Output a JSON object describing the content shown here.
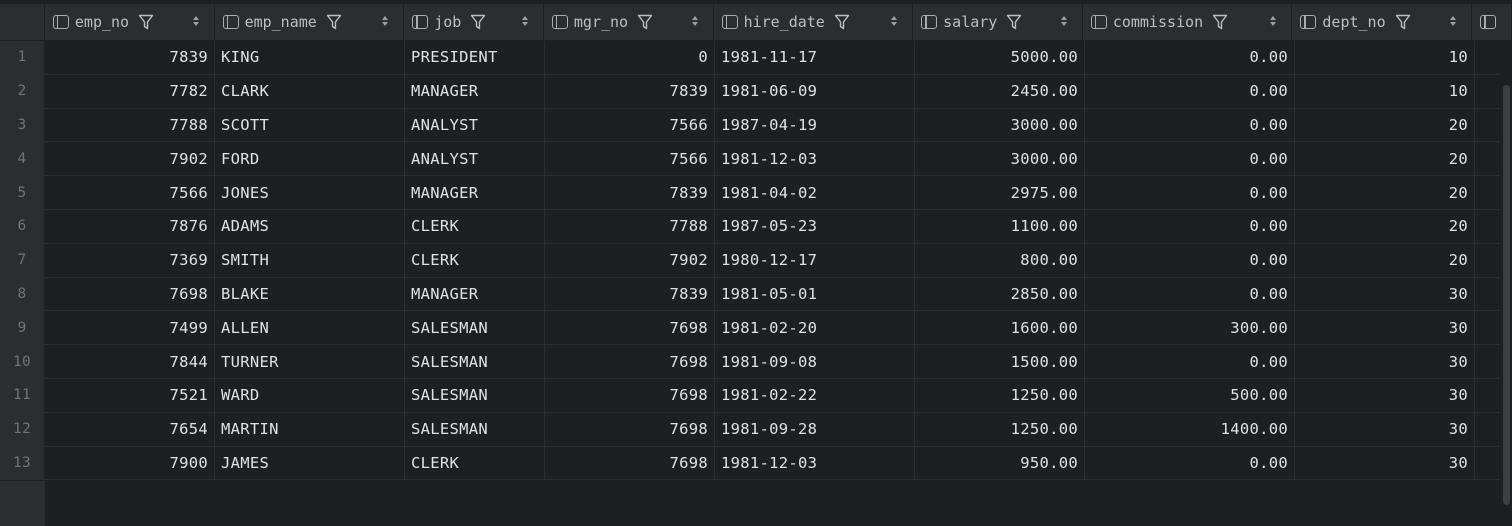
{
  "columns": [
    {
      "name": "emp_no",
      "sort": true
    },
    {
      "name": "emp_name",
      "sort": true
    },
    {
      "name": "job",
      "sort": true
    },
    {
      "name": "mgr_no",
      "sort": true
    },
    {
      "name": "hire_date",
      "sort": true
    },
    {
      "name": "salary",
      "sort": true
    },
    {
      "name": "commission",
      "sort": true
    },
    {
      "name": "dept_no",
      "sort": true
    }
  ],
  "rows": [
    {
      "n": "1",
      "emp_no": "7839",
      "emp_name": "KING",
      "job": "PRESIDENT",
      "mgr_no": "0",
      "hire_date": "1981-11-17",
      "salary": "5000.00",
      "commission": "0.00",
      "dept_no": "10"
    },
    {
      "n": "2",
      "emp_no": "7782",
      "emp_name": "CLARK",
      "job": "MANAGER",
      "mgr_no": "7839",
      "hire_date": "1981-06-09",
      "salary": "2450.00",
      "commission": "0.00",
      "dept_no": "10"
    },
    {
      "n": "3",
      "emp_no": "7788",
      "emp_name": "SCOTT",
      "job": "ANALYST",
      "mgr_no": "7566",
      "hire_date": "1987-04-19",
      "salary": "3000.00",
      "commission": "0.00",
      "dept_no": "20"
    },
    {
      "n": "4",
      "emp_no": "7902",
      "emp_name": "FORD",
      "job": "ANALYST",
      "mgr_no": "7566",
      "hire_date": "1981-12-03",
      "salary": "3000.00",
      "commission": "0.00",
      "dept_no": "20"
    },
    {
      "n": "5",
      "emp_no": "7566",
      "emp_name": "JONES",
      "job": "MANAGER",
      "mgr_no": "7839",
      "hire_date": "1981-04-02",
      "salary": "2975.00",
      "commission": "0.00",
      "dept_no": "20"
    },
    {
      "n": "6",
      "emp_no": "7876",
      "emp_name": "ADAMS",
      "job": "CLERK",
      "mgr_no": "7788",
      "hire_date": "1987-05-23",
      "salary": "1100.00",
      "commission": "0.00",
      "dept_no": "20"
    },
    {
      "n": "7",
      "emp_no": "7369",
      "emp_name": "SMITH",
      "job": "CLERK",
      "mgr_no": "7902",
      "hire_date": "1980-12-17",
      "salary": "800.00",
      "commission": "0.00",
      "dept_no": "20"
    },
    {
      "n": "8",
      "emp_no": "7698",
      "emp_name": "BLAKE",
      "job": "MANAGER",
      "mgr_no": "7839",
      "hire_date": "1981-05-01",
      "salary": "2850.00",
      "commission": "0.00",
      "dept_no": "30"
    },
    {
      "n": "9",
      "emp_no": "7499",
      "emp_name": "ALLEN",
      "job": "SALESMAN",
      "mgr_no": "7698",
      "hire_date": "1981-02-20",
      "salary": "1600.00",
      "commission": "300.00",
      "dept_no": "30"
    },
    {
      "n": "10",
      "emp_no": "7844",
      "emp_name": "TURNER",
      "job": "SALESMAN",
      "mgr_no": "7698",
      "hire_date": "1981-09-08",
      "salary": "1500.00",
      "commission": "0.00",
      "dept_no": "30"
    },
    {
      "n": "11",
      "emp_no": "7521",
      "emp_name": "WARD",
      "job": "SALESMAN",
      "mgr_no": "7698",
      "hire_date": "1981-02-22",
      "salary": "1250.00",
      "commission": "500.00",
      "dept_no": "30"
    },
    {
      "n": "12",
      "emp_no": "7654",
      "emp_name": "MARTIN",
      "job": "SALESMAN",
      "mgr_no": "7698",
      "hire_date": "1981-09-28",
      "salary": "1250.00",
      "commission": "1400.00",
      "dept_no": "30"
    },
    {
      "n": "13",
      "emp_no": "7900",
      "emp_name": "JAMES",
      "job": "CLERK",
      "mgr_no": "7698",
      "hire_date": "1981-12-03",
      "salary": "950.00",
      "commission": "0.00",
      "dept_no": "30"
    }
  ]
}
